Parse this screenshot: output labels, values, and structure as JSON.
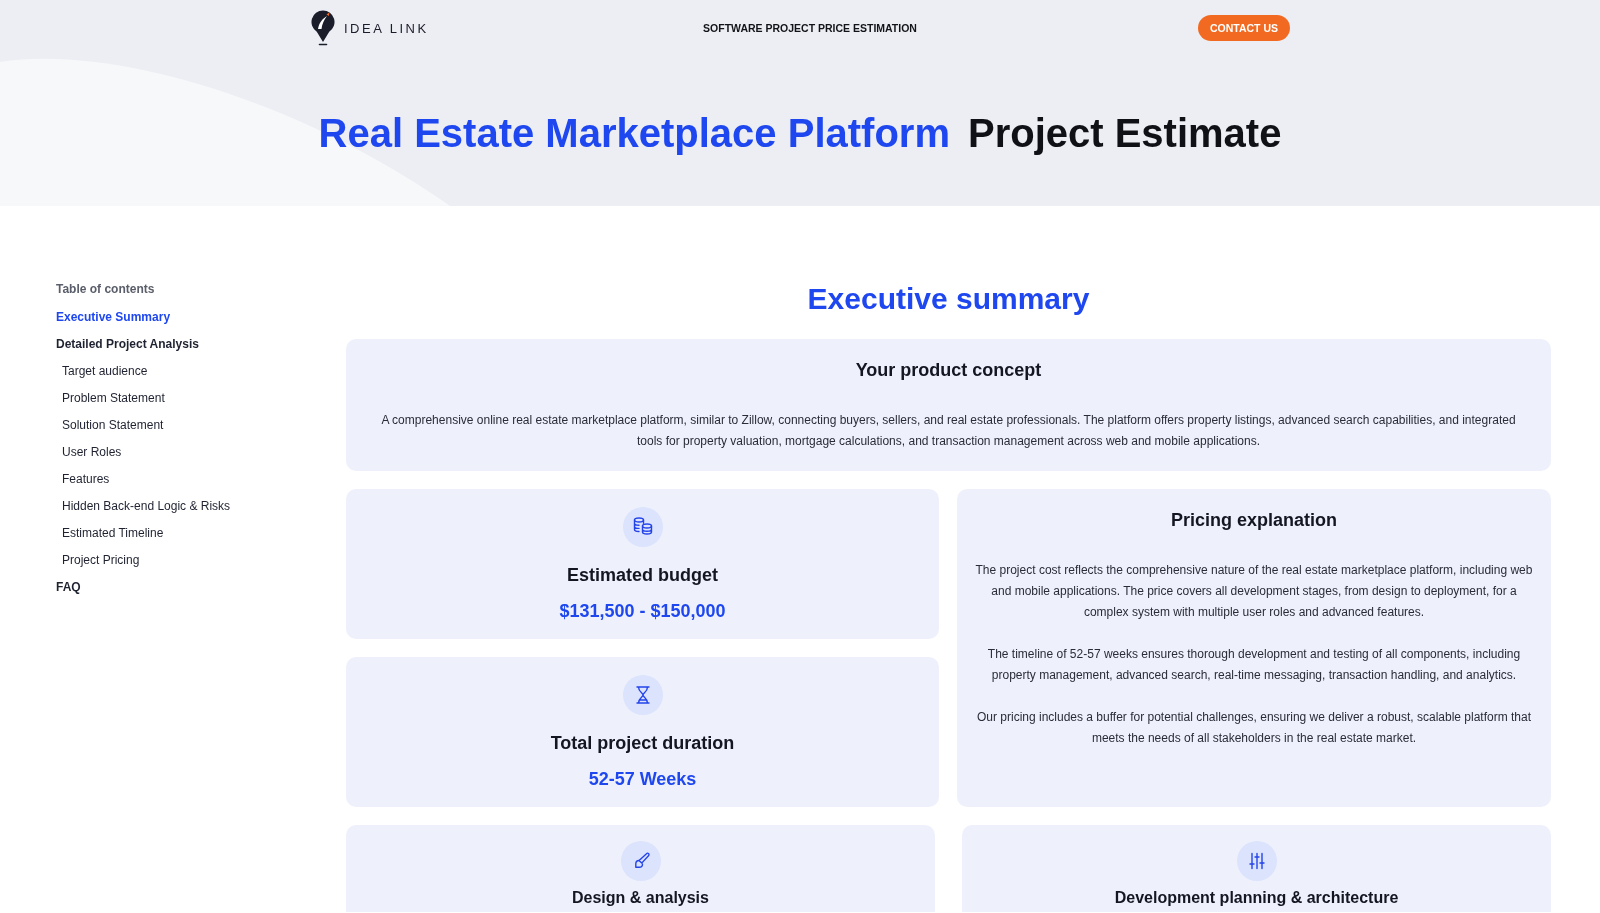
{
  "header": {
    "logo": "IDEA LINK",
    "nav_link": "SOFTWARE PROJECT PRICE ESTIMATION",
    "contact_button": "CONTACT US"
  },
  "hero": {
    "title_highlight": "Real Estate Marketplace Platform",
    "title_rest": "Project Estimate"
  },
  "sidebar": {
    "heading": "Table of contents",
    "items": [
      {
        "label": "Executive Summary",
        "selected": true
      },
      {
        "label": "Detailed Project Analysis",
        "selected": false,
        "children": [
          {
            "label": "Target audience",
            "selected": false
          },
          {
            "label": "Problem Statement",
            "selected": false
          },
          {
            "label": "Solution Statement",
            "selected": false
          },
          {
            "label": "User Roles",
            "selected": false
          },
          {
            "label": "Features",
            "selected": false
          },
          {
            "label": "Hidden Back-end Logic & Risks",
            "selected": false
          },
          {
            "label": "Estimated Timeline",
            "selected": false
          },
          {
            "label": "Project Pricing",
            "selected": false
          }
        ]
      },
      {
        "label": "FAQ",
        "selected": false
      }
    ]
  },
  "summary": {
    "heading": "Executive summary",
    "concept": {
      "title": "Your product concept",
      "text": "A comprehensive online real estate marketplace platform, similar to Zillow, connecting buyers, sellers, and real estate professionals. The platform offers property listings, advanced search capabilities, and integrated tools for property valuation, mortgage calculations, and transaction management across web and mobile applications."
    },
    "budget": {
      "title": "Estimated budget",
      "value": "$131,500 - $150,000"
    },
    "duration": {
      "title": "Total project duration",
      "value": "52-57 Weeks"
    },
    "pricing": {
      "title": "Pricing explanation",
      "paragraphs": [
        "The project cost reflects the comprehensive nature of the real estate marketplace platform, including web and mobile applications. The price covers all development stages, from design to deployment, for a complex system with multiple user roles and advanced features.",
        "The timeline of 52-57 weeks ensures thorough development and testing of all components, including property management, advanced search, real-time messaging, transaction handling, and analytics.",
        "Our pricing includes a buffer for potential challenges, ensuring we deliver a robust, scalable platform that meets the needs of all stakeholders in the real estate market."
      ]
    },
    "phases": [
      {
        "title": "Design & analysis"
      },
      {
        "title": "Development planning & architecture"
      }
    ]
  }
}
